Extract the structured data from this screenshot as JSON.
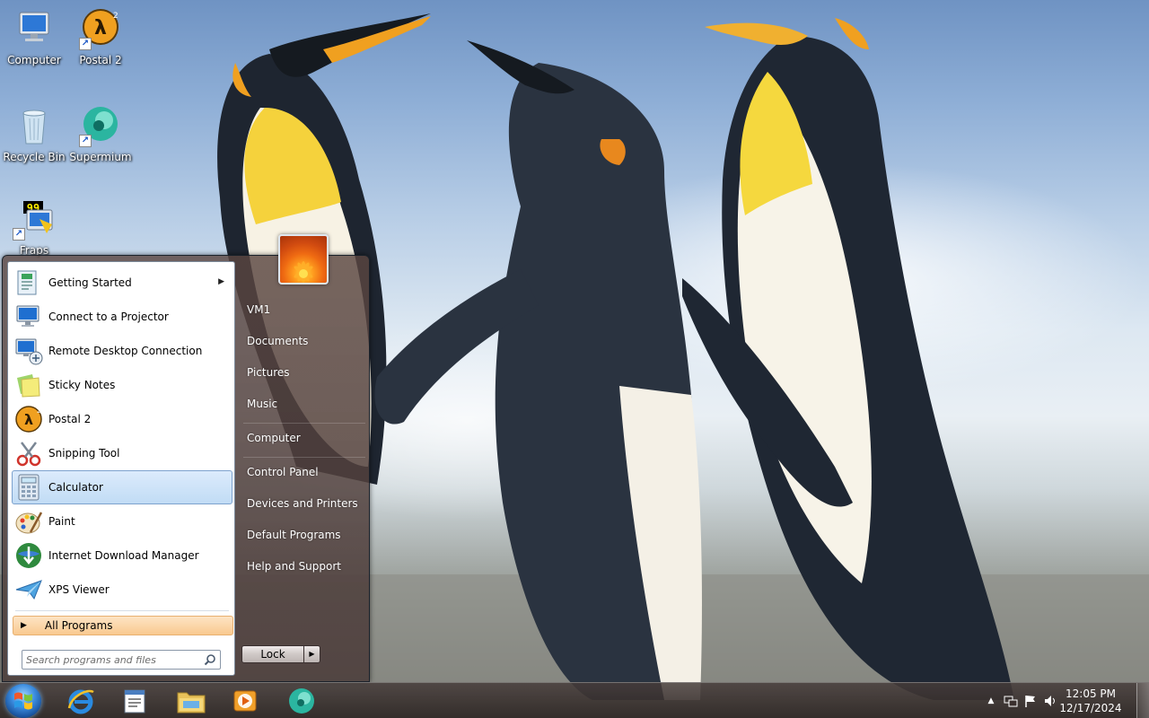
{
  "desktop": {
    "icons": [
      {
        "label": "Computer",
        "icon": "computer-icon"
      },
      {
        "label": "Postal 2",
        "icon": "postal2-icon"
      },
      {
        "label": "Recycle Bin",
        "icon": "recycle-bin-icon"
      },
      {
        "label": "Supermium",
        "icon": "supermium-icon"
      },
      {
        "label": "Fraps",
        "icon": "fraps-icon"
      }
    ]
  },
  "start_menu": {
    "programs": [
      {
        "label": "Getting Started",
        "icon": "getting-started-icon",
        "has_submenu": true
      },
      {
        "label": "Connect to a Projector",
        "icon": "projector-icon"
      },
      {
        "label": "Remote Desktop Connection",
        "icon": "remote-desktop-icon"
      },
      {
        "label": "Sticky Notes",
        "icon": "sticky-notes-icon"
      },
      {
        "label": "Postal 2",
        "icon": "postal2-icon"
      },
      {
        "label": "Snipping Tool",
        "icon": "snipping-tool-icon"
      },
      {
        "label": "Calculator",
        "icon": "calculator-icon",
        "selected": true
      },
      {
        "label": "Paint",
        "icon": "paint-icon"
      },
      {
        "label": "Internet Download Manager",
        "icon": "idm-icon"
      },
      {
        "label": "XPS Viewer",
        "icon": "xps-viewer-icon"
      }
    ],
    "all_programs_label": "All Programs",
    "search_placeholder": "Search programs and files",
    "right_items": {
      "user": "VM1",
      "documents": "Documents",
      "pictures": "Pictures",
      "music": "Music",
      "computer": "Computer",
      "control_panel": "Control Panel",
      "devices_printers": "Devices and Printers",
      "default_programs": "Default Programs",
      "help_support": "Help and Support"
    },
    "lock_label": "Lock"
  },
  "taskbar": {
    "pinned": [
      "internet-explorer-icon",
      "notepad-icon",
      "file-explorer-icon",
      "media-player-icon",
      "supermium-icon"
    ],
    "clock_time": "12:05 PM",
    "clock_date": "12/17/2024"
  },
  "colors": {
    "selection": "#c1dcf5",
    "all_programs": "#f9c98f",
    "taskbar": "#3a302e"
  }
}
